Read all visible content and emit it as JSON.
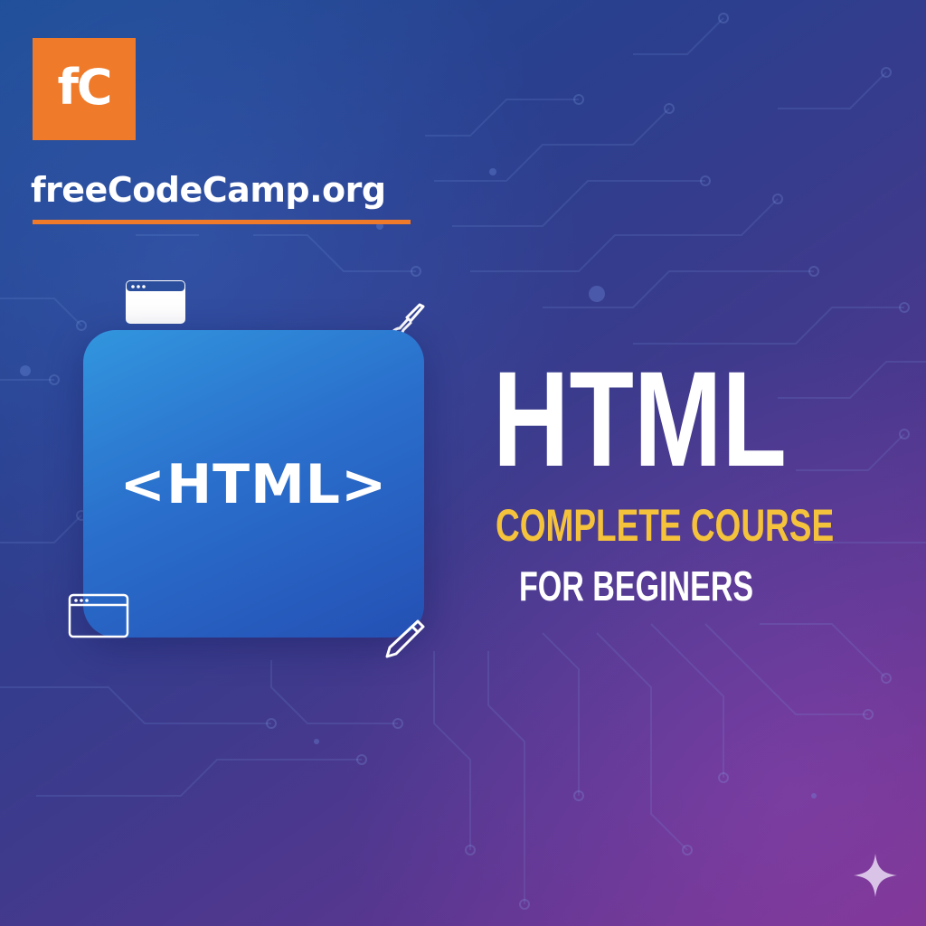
{
  "brand": {
    "logo_text": "fC",
    "name": "freeCodeCamp.org",
    "accent_color": "#ef7a2a"
  },
  "tile": {
    "code_text": "<HTML>",
    "color": "#2a6fcc"
  },
  "title": {
    "main": "HTML",
    "line_1": "COMPLETE COURSE",
    "line_2": "FOR BEGINERS",
    "line_1_color": "#f5c23b"
  },
  "icons": {
    "browser_window_top": "browser-window-icon",
    "browser_window_bottom": "browser-window-icon",
    "brush": "paintbrush-icon",
    "pencil": "pencil-icon",
    "sparkle": "sparkle-icon"
  },
  "background": {
    "gradient_start": "#1f4d96",
    "gradient_end": "#78338f"
  }
}
